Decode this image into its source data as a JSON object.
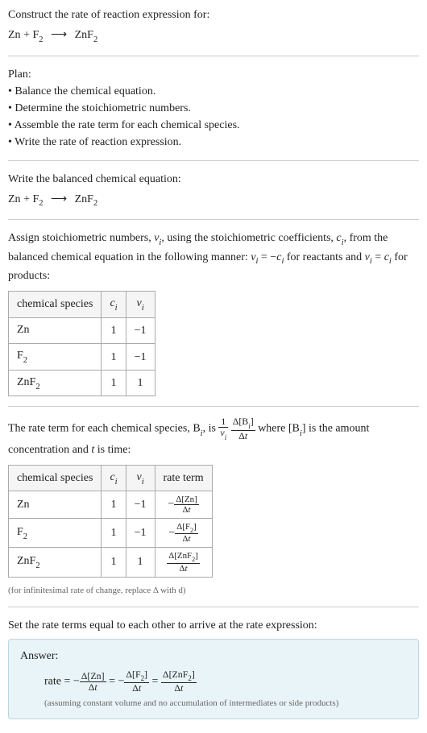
{
  "header": {
    "prompt": "Construct the rate of reaction expression for:",
    "equation_lhs1": "Zn",
    "equation_plus": " + ",
    "equation_lhs2": "F",
    "equation_lhs2_sub": "2",
    "equation_arrow": "⟶",
    "equation_rhs1": "ZnF",
    "equation_rhs1_sub": "2"
  },
  "plan": {
    "title": "Plan:",
    "items": [
      "Balance the chemical equation.",
      "Determine the stoichiometric numbers.",
      "Assemble the rate term for each chemical species.",
      "Write the rate of reaction expression."
    ]
  },
  "balanced": {
    "title": "Write the balanced chemical equation:"
  },
  "assign": {
    "text_a": "Assign stoichiometric numbers, ",
    "nu_i": "ν",
    "nu_i_sub": "i",
    "text_b": ", using the stoichiometric coefficients, ",
    "c_i": "c",
    "c_i_sub": "i",
    "text_c": ", from the balanced chemical equation in the following manner: ",
    "eq1_lhs": "ν",
    "eq1_lhs_sub": "i",
    "eq1_eq": " = −",
    "eq1_rhs": "c",
    "eq1_rhs_sub": "i",
    "text_d": " for reactants and ",
    "eq2_lhs": "ν",
    "eq2_lhs_sub": "i",
    "eq2_eq": " = ",
    "eq2_rhs": "c",
    "eq2_rhs_sub": "i",
    "text_e": " for products:"
  },
  "table1": {
    "headers": {
      "species": "chemical species",
      "ci": "c",
      "ci_sub": "i",
      "nui": "ν",
      "nui_sub": "i"
    },
    "rows": [
      {
        "species": "Zn",
        "species_sub": "",
        "ci": "1",
        "nui": "−1"
      },
      {
        "species": "F",
        "species_sub": "2",
        "ci": "1",
        "nui": "−1"
      },
      {
        "species": "ZnF",
        "species_sub": "2",
        "ci": "1",
        "nui": "1"
      }
    ]
  },
  "rate_text": {
    "a": "The rate term for each chemical species, B",
    "a_sub": "i",
    "b": ", is ",
    "frac1_num": "1",
    "frac1_den_a": "ν",
    "frac1_den_sub": "i",
    "frac2_num_a": "Δ[B",
    "frac2_num_sub": "i",
    "frac2_num_b": "]",
    "frac2_den": "Δt",
    "c": " where [B",
    "c_sub": "i",
    "d": "] is the amount concentration and ",
    "t": "t",
    "e": " is time:"
  },
  "table2": {
    "headers": {
      "species": "chemical species",
      "ci": "c",
      "ci_sub": "i",
      "nui": "ν",
      "nui_sub": "i",
      "rate": "rate term"
    },
    "rows": [
      {
        "species": "Zn",
        "species_sub": "",
        "ci": "1",
        "nui": "−1",
        "sign": "−",
        "conc": "Δ[Zn]",
        "den": "Δt"
      },
      {
        "species": "F",
        "species_sub": "2",
        "ci": "1",
        "nui": "−1",
        "sign": "−",
        "conc": "Δ[F",
        "conc_sub": "2",
        "conc_b": "]",
        "den": "Δt"
      },
      {
        "species": "ZnF",
        "species_sub": "2",
        "ci": "1",
        "nui": "1",
        "sign": "",
        "conc": "Δ[ZnF",
        "conc_sub": "2",
        "conc_b": "]",
        "den": "Δt"
      }
    ],
    "note": "(for infinitesimal rate of change, replace Δ with d)"
  },
  "set_text": "Set the rate terms equal to each other to arrive at the rate expression:",
  "answer": {
    "label": "Answer:",
    "rate_word": "rate = −",
    "t1_num": "Δ[Zn]",
    "t1_den": "Δt",
    "eq1": " = −",
    "t2_num_a": "Δ[F",
    "t2_num_sub": "2",
    "t2_num_b": "]",
    "t2_den": "Δt",
    "eq2": " = ",
    "t3_num_a": "Δ[ZnF",
    "t3_num_sub": "2",
    "t3_num_b": "]",
    "t3_den": "Δt",
    "assumption": "(assuming constant volume and no accumulation of intermediates or side products)"
  }
}
